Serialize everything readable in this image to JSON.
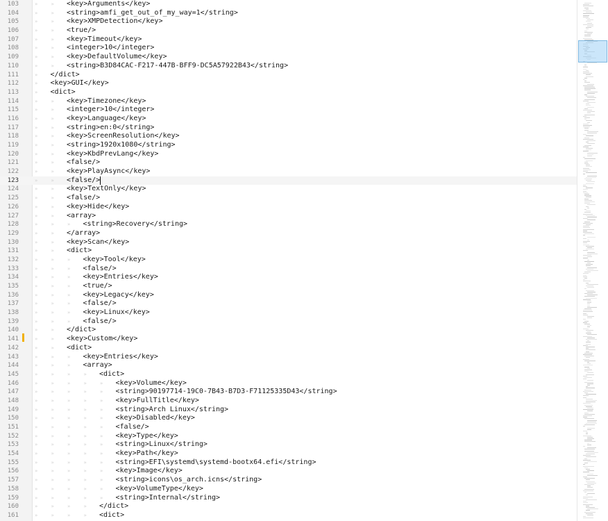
{
  "editor": {
    "caret_line": 123,
    "modified_line": 141,
    "lines": [
      {
        "num": "103",
        "indent": 2,
        "text": "<key>Arguments</key>"
      },
      {
        "num": "104",
        "indent": 2,
        "text": "<string>amfi_get_out_of_my_way=1</string>"
      },
      {
        "num": "105",
        "indent": 2,
        "text": "<key>XMPDetection</key>"
      },
      {
        "num": "106",
        "indent": 2,
        "text": "<true/>"
      },
      {
        "num": "107",
        "indent": 2,
        "text": "<key>Timeout</key>"
      },
      {
        "num": "108",
        "indent": 2,
        "text": "<integer>10</integer>"
      },
      {
        "num": "109",
        "indent": 2,
        "text": "<key>DefaultVolume</key>"
      },
      {
        "num": "110",
        "indent": 2,
        "text": "<string>B3D84CAC-F217-447B-BFF9-DC5A57922B43</string>"
      },
      {
        "num": "111",
        "indent": 1,
        "text": "</dict>"
      },
      {
        "num": "112",
        "indent": 1,
        "text": "<key>GUI</key>"
      },
      {
        "num": "113",
        "indent": 1,
        "text": "<dict>"
      },
      {
        "num": "114",
        "indent": 2,
        "text": "<key>Timezone</key>"
      },
      {
        "num": "115",
        "indent": 2,
        "text": "<integer>10</integer>"
      },
      {
        "num": "116",
        "indent": 2,
        "text": "<key>Language</key>"
      },
      {
        "num": "117",
        "indent": 2,
        "text": "<string>en:0</string>"
      },
      {
        "num": "118",
        "indent": 2,
        "text": "<key>ScreenResolution</key>"
      },
      {
        "num": "119",
        "indent": 2,
        "text": "<string>1920x1080</string>"
      },
      {
        "num": "120",
        "indent": 2,
        "text": "<key>KbdPrevLang</key>"
      },
      {
        "num": "121",
        "indent": 2,
        "text": "<false/>"
      },
      {
        "num": "122",
        "indent": 2,
        "text": "<key>PlayAsync</key>"
      },
      {
        "num": "123",
        "indent": 2,
        "text": "<false/>"
      },
      {
        "num": "124",
        "indent": 2,
        "text": "<key>TextOnly</key>"
      },
      {
        "num": "125",
        "indent": 2,
        "text": "<false/>"
      },
      {
        "num": "126",
        "indent": 2,
        "text": "<key>Hide</key>"
      },
      {
        "num": "127",
        "indent": 2,
        "text": "<array>"
      },
      {
        "num": "128",
        "indent": 3,
        "text": "<string>Recovery</string>"
      },
      {
        "num": "129",
        "indent": 2,
        "text": "</array>"
      },
      {
        "num": "130",
        "indent": 2,
        "text": "<key>Scan</key>"
      },
      {
        "num": "131",
        "indent": 2,
        "text": "<dict>"
      },
      {
        "num": "132",
        "indent": 3,
        "text": "<key>Tool</key>"
      },
      {
        "num": "133",
        "indent": 3,
        "text": "<false/>"
      },
      {
        "num": "134",
        "indent": 3,
        "text": "<key>Entries</key>"
      },
      {
        "num": "135",
        "indent": 3,
        "text": "<true/>"
      },
      {
        "num": "136",
        "indent": 3,
        "text": "<key>Legacy</key>"
      },
      {
        "num": "137",
        "indent": 3,
        "text": "<false/>"
      },
      {
        "num": "138",
        "indent": 3,
        "text": "<key>Linux</key>"
      },
      {
        "num": "139",
        "indent": 3,
        "text": "<false/>"
      },
      {
        "num": "140",
        "indent": 2,
        "text": "</dict>"
      },
      {
        "num": "141",
        "indent": 2,
        "text": "<key>Custom</key>"
      },
      {
        "num": "142",
        "indent": 2,
        "text": "<dict>"
      },
      {
        "num": "143",
        "indent": 3,
        "text": "<key>Entries</key>"
      },
      {
        "num": "144",
        "indent": 3,
        "text": "<array>"
      },
      {
        "num": "145",
        "indent": 4,
        "text": "<dict>"
      },
      {
        "num": "146",
        "indent": 5,
        "text": "<key>Volume</key>"
      },
      {
        "num": "147",
        "indent": 5,
        "text": "<string>90197714-19C0-7B43-B7D3-F71125335D43</string>"
      },
      {
        "num": "148",
        "indent": 5,
        "text": "<key>FullTitle</key>"
      },
      {
        "num": "149",
        "indent": 5,
        "text": "<string>Arch Linux</string>"
      },
      {
        "num": "150",
        "indent": 5,
        "text": "<key>Disabled</key>"
      },
      {
        "num": "151",
        "indent": 5,
        "text": "<false/>"
      },
      {
        "num": "152",
        "indent": 5,
        "text": "<key>Type</key>"
      },
      {
        "num": "153",
        "indent": 5,
        "text": "<string>Linux</string>"
      },
      {
        "num": "154",
        "indent": 5,
        "text": "<key>Path</key>"
      },
      {
        "num": "155",
        "indent": 5,
        "text": "<string>EFI\\systemd\\systemd-bootx64.efi</string>"
      },
      {
        "num": "156",
        "indent": 5,
        "text": "<key>Image</key>"
      },
      {
        "num": "157",
        "indent": 5,
        "text": "<string>icons\\os_arch.icns</string>"
      },
      {
        "num": "158",
        "indent": 5,
        "text": "<key>VolumeType</key>"
      },
      {
        "num": "159",
        "indent": 5,
        "text": "<string>Internal</string>"
      },
      {
        "num": "160",
        "indent": 4,
        "text": "</dict>"
      },
      {
        "num": "161",
        "indent": 4,
        "text": "<dict>"
      }
    ]
  },
  "tab_glyph": "»",
  "colors": {
    "gutter_bg": "#f3f3f3",
    "modified_marker": "#f0b000",
    "minimap_viewport": "#a0d2f5"
  }
}
